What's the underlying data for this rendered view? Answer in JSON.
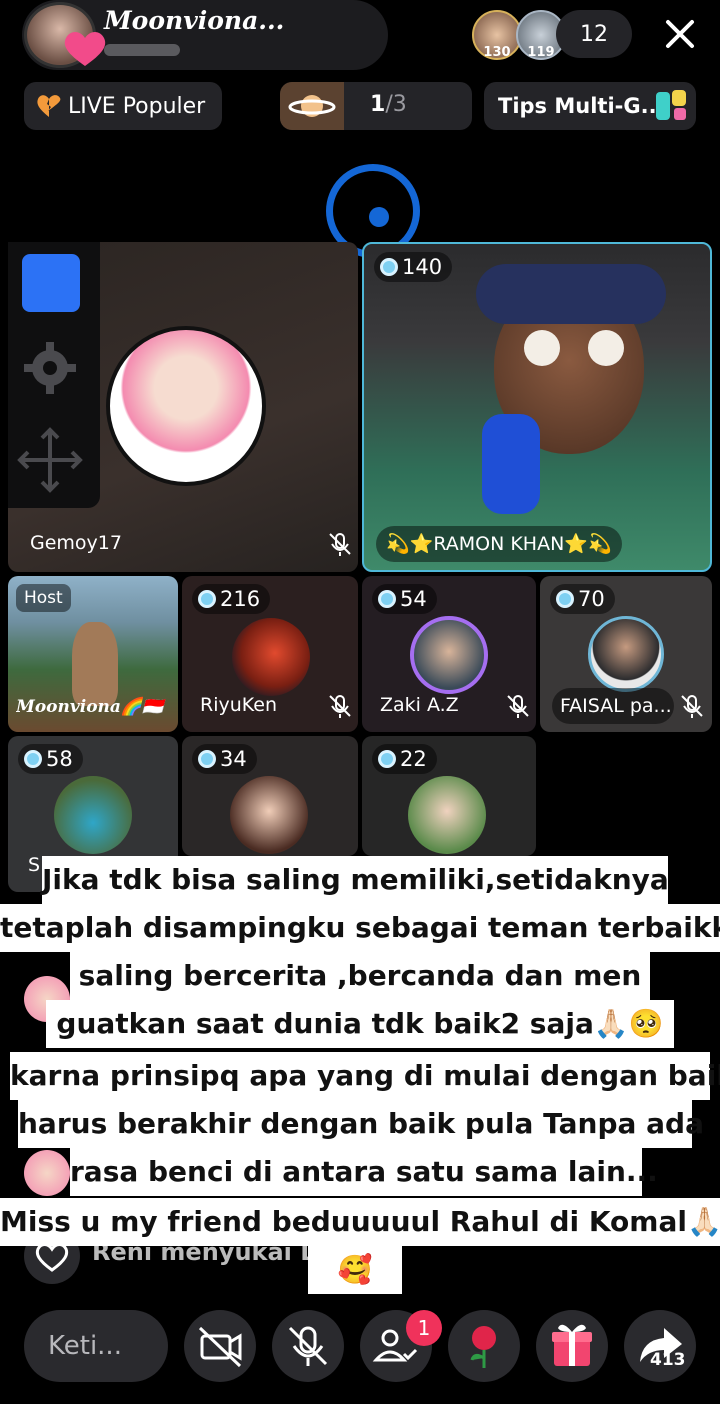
{
  "header": {
    "host_name": "Moonviona...",
    "viewer_badges": [
      "130",
      "119"
    ],
    "viewer_count": "12"
  },
  "top_bar": {
    "live_label": "LIVE Populer",
    "page_current": "1",
    "page_sep_total": "/3",
    "tips_label": "Tips Multi-G..."
  },
  "tiles": {
    "gemoy": {
      "name": "Gemoy17"
    },
    "ramon": {
      "badge": "140",
      "name": "💫⭐RAMON KHAN⭐💫"
    },
    "host": {
      "label": "Host",
      "name": "Moonviona🌈🇮🇩"
    },
    "riyu": {
      "badge": "216",
      "name": "RiyuKen"
    },
    "zaki": {
      "badge": "54",
      "name": "Zaki A.Z"
    },
    "faisal": {
      "badge": "70",
      "name": "FAISAL pa..."
    },
    "t58": {
      "badge": "58",
      "name": "S"
    },
    "t34": {
      "badge": "34"
    },
    "t22": {
      "badge": "22"
    }
  },
  "overlay_text": [
    "Jika tdk bisa saling memiliki,setidaknya",
    "tetaplah disampingku sebagai teman terbaikku",
    "saling bercerita ,bercanda dan men",
    "guatkan saat dunia tdk baik2 saja🙏🏻🥺",
    "karna prinsipq apa yang di mulai dengan baik",
    "harus berakhir dengan baik pula Tanpa ada",
    "rasa benci di antara satu sama lain...",
    "Miss u my friend beduuuuul Rahul di Komal🙏🏻",
    "🥰"
  ],
  "activity": {
    "text": "Reni menyukai LI"
  },
  "bottom": {
    "input_placeholder": "Keti...",
    "notification_count": "1",
    "share_count": "413"
  },
  "colors": {
    "accent": "#1467d6",
    "notification": "#f0325b",
    "tile_border": "#4fb8d8"
  }
}
